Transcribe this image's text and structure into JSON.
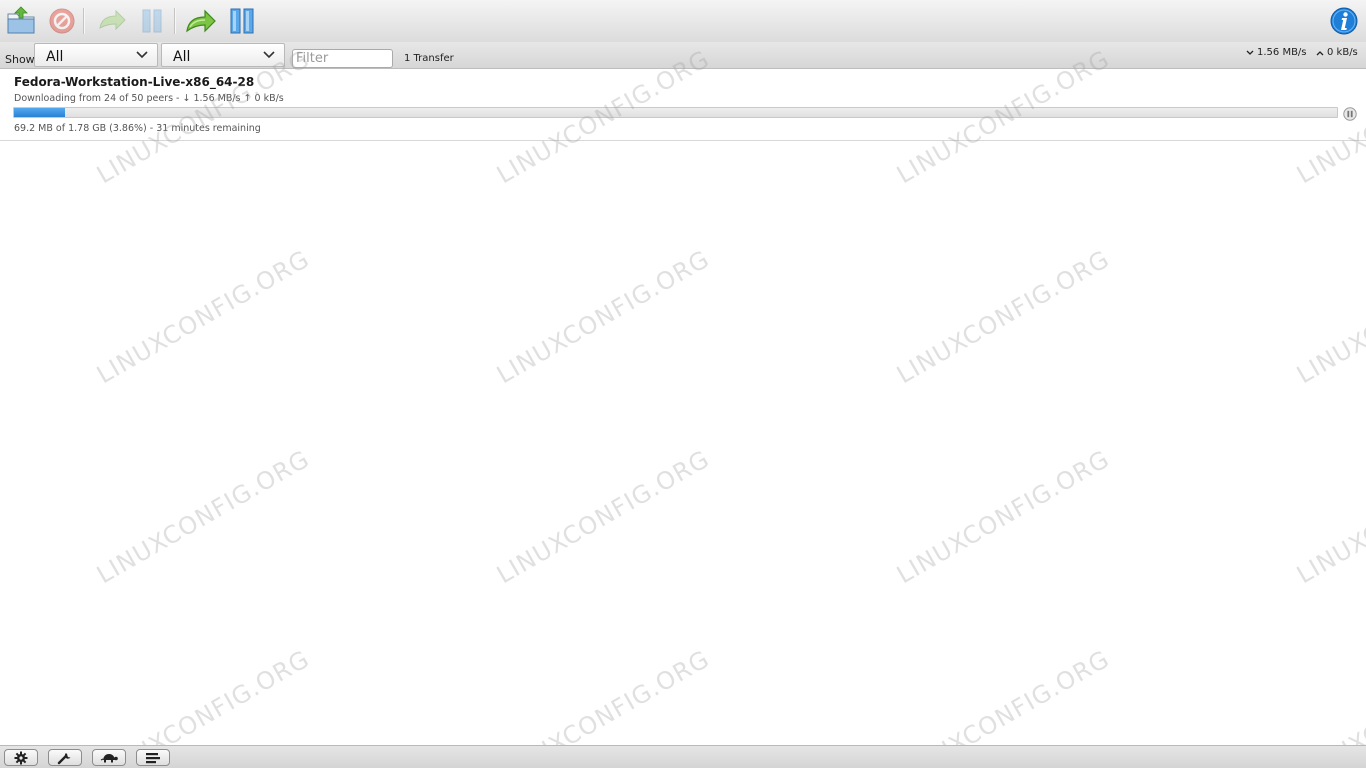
{
  "toolbar": {
    "buttons": {
      "open": {
        "icon": "open-folder-icon"
      },
      "remove": {
        "icon": "remove-icon"
      },
      "resume": {
        "icon": "resume-icon"
      },
      "pause": {
        "icon": "pause-icon"
      },
      "resume_all": {
        "icon": "resume-all-icon"
      },
      "pause_all": {
        "icon": "pause-all-icon"
      },
      "info": {
        "icon": "info-icon"
      }
    }
  },
  "filterbar": {
    "show_label": "Show",
    "state_filter": "All",
    "tracker_filter": "All",
    "search_placeholder": "Filter",
    "transfer_count": "1 Transfer",
    "download_speed": "1.56 MB/s",
    "upload_speed": "0 kB/s"
  },
  "torrent": {
    "name": "Fedora-Workstation-Live-x86_64-28",
    "peers_status": "Downloading from 24 of 50 peers - ↓ 1.56 MB/s ↑ 0 kB/s",
    "progress_text": "69.2 MB of 1.78 GB (3.86%) - 31 minutes remaining",
    "progress_fraction": 0.0386
  },
  "watermark": "LINUXCONFIG.ORG",
  "bottombar": {
    "buttons": [
      "gear-icon",
      "wrench-icon",
      "turtle-icon",
      "compact-view-icon"
    ]
  },
  "colors": {
    "progress_fill": "#2f88dc",
    "toolbar_bg": "#e4e4e4",
    "info_blue": "#1e7fd8"
  }
}
